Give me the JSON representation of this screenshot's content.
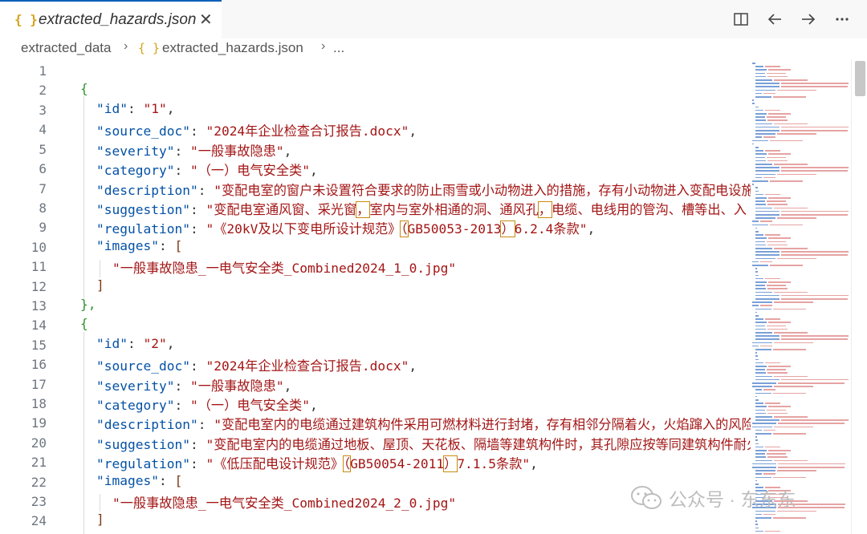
{
  "tab": {
    "icon": "{ }",
    "title": "extracted_hazards.json",
    "close": "✕"
  },
  "breadcrumb": {
    "folder": "extracted_data",
    "file_icon": "{ }",
    "file": "extracted_hazards.json",
    "more": "..."
  },
  "toolbar_icons": [
    "split-editor-icon",
    "go-back-icon",
    "go-forward-icon",
    "more-actions-icon"
  ],
  "watermark": {
    "text": "公众号 · 东东东"
  },
  "lines": [
    "1",
    "2",
    "3",
    "4",
    "5",
    "6",
    "7",
    "8",
    "9",
    "10",
    "11",
    "12",
    "13",
    "14",
    "15",
    "16",
    "17",
    "18",
    "19",
    "20",
    "21",
    "22",
    "23",
    "24"
  ],
  "records": [
    {
      "id_key": "\"id\"",
      "id": "\"1\"",
      "source_doc_key": "\"source_doc\"",
      "source_doc": "\"2024年企业检查合订报告.docx\"",
      "severity_key": "\"severity\"",
      "severity": "\"一般事故隐患\"",
      "category_key": "\"category\"",
      "category": "\"（一）电气安全类\"",
      "description_key": "\"description\"",
      "description": "\"变配电室的窗户未设置符合要求的防止雨雪或小动物进入的措施，存有小动物进入变配电设施",
      "suggestion_key": "\"suggestion\"",
      "suggestion_a": "\"变配电室通风窗、采光窗",
      "suggestion_b": "，",
      "suggestion_c": "室内与室外相通的洞、通风孔",
      "suggestion_d": "，",
      "suggestion_e": "电缆、电线用的管沟、槽等出、入",
      "regulation_key": "\"regulation\"",
      "regulation_a": "\"《20kV及以下变电所设计规范》",
      "regulation_b": "（",
      "regulation_c": "GB50053-2013",
      "regulation_d": "）",
      "regulation_e": "6.2.4条款\"",
      "images_key": "\"images\"",
      "image": "\"一般事故隐患_一电气安全类_Combined2024_1_0.jpg\""
    },
    {
      "id_key": "\"id\"",
      "id": "\"2\"",
      "source_doc_key": "\"source_doc\"",
      "source_doc": "\"2024年企业检查合订报告.docx\"",
      "severity_key": "\"severity\"",
      "severity": "\"一般事故隐患\"",
      "category_key": "\"category\"",
      "category": "\"（一）电气安全类\"",
      "description_key": "\"description\"",
      "description": "\"变配电室内的电缆通过建筑构件采用可燃材料进行封堵，存有相邻分隔着火，火焰蹿入的风险",
      "suggestion_key": "\"suggestion\"",
      "suggestion": "\"变配电室内的电缆通过地板、屋顶、天花板、隔墙等建筑构件时，其孔隙应按等同建筑构件耐火",
      "regulation_key": "\"regulation\"",
      "regulation_a": "\"《低压配电设计规范》",
      "regulation_b": "（",
      "regulation_c": "GB50054-2011",
      "regulation_d": "）",
      "regulation_e": "7.1.5条款\"",
      "images_key": "\"images\"",
      "image": "\"一般事故隐患_一电气安全类_Combined2024_2_0.jpg\""
    }
  ],
  "punct": {
    "open_obj": "{",
    "close_obj_comma": "},",
    "open_arr": "[",
    "close_arr": "]",
    "colon": ": ",
    "comma": ","
  },
  "colors": {
    "key": "#0451a5",
    "string": "#a31515",
    "bracket_obj": "#319331",
    "bracket_arr": "#7b3814",
    "accent": "#005fb8"
  }
}
